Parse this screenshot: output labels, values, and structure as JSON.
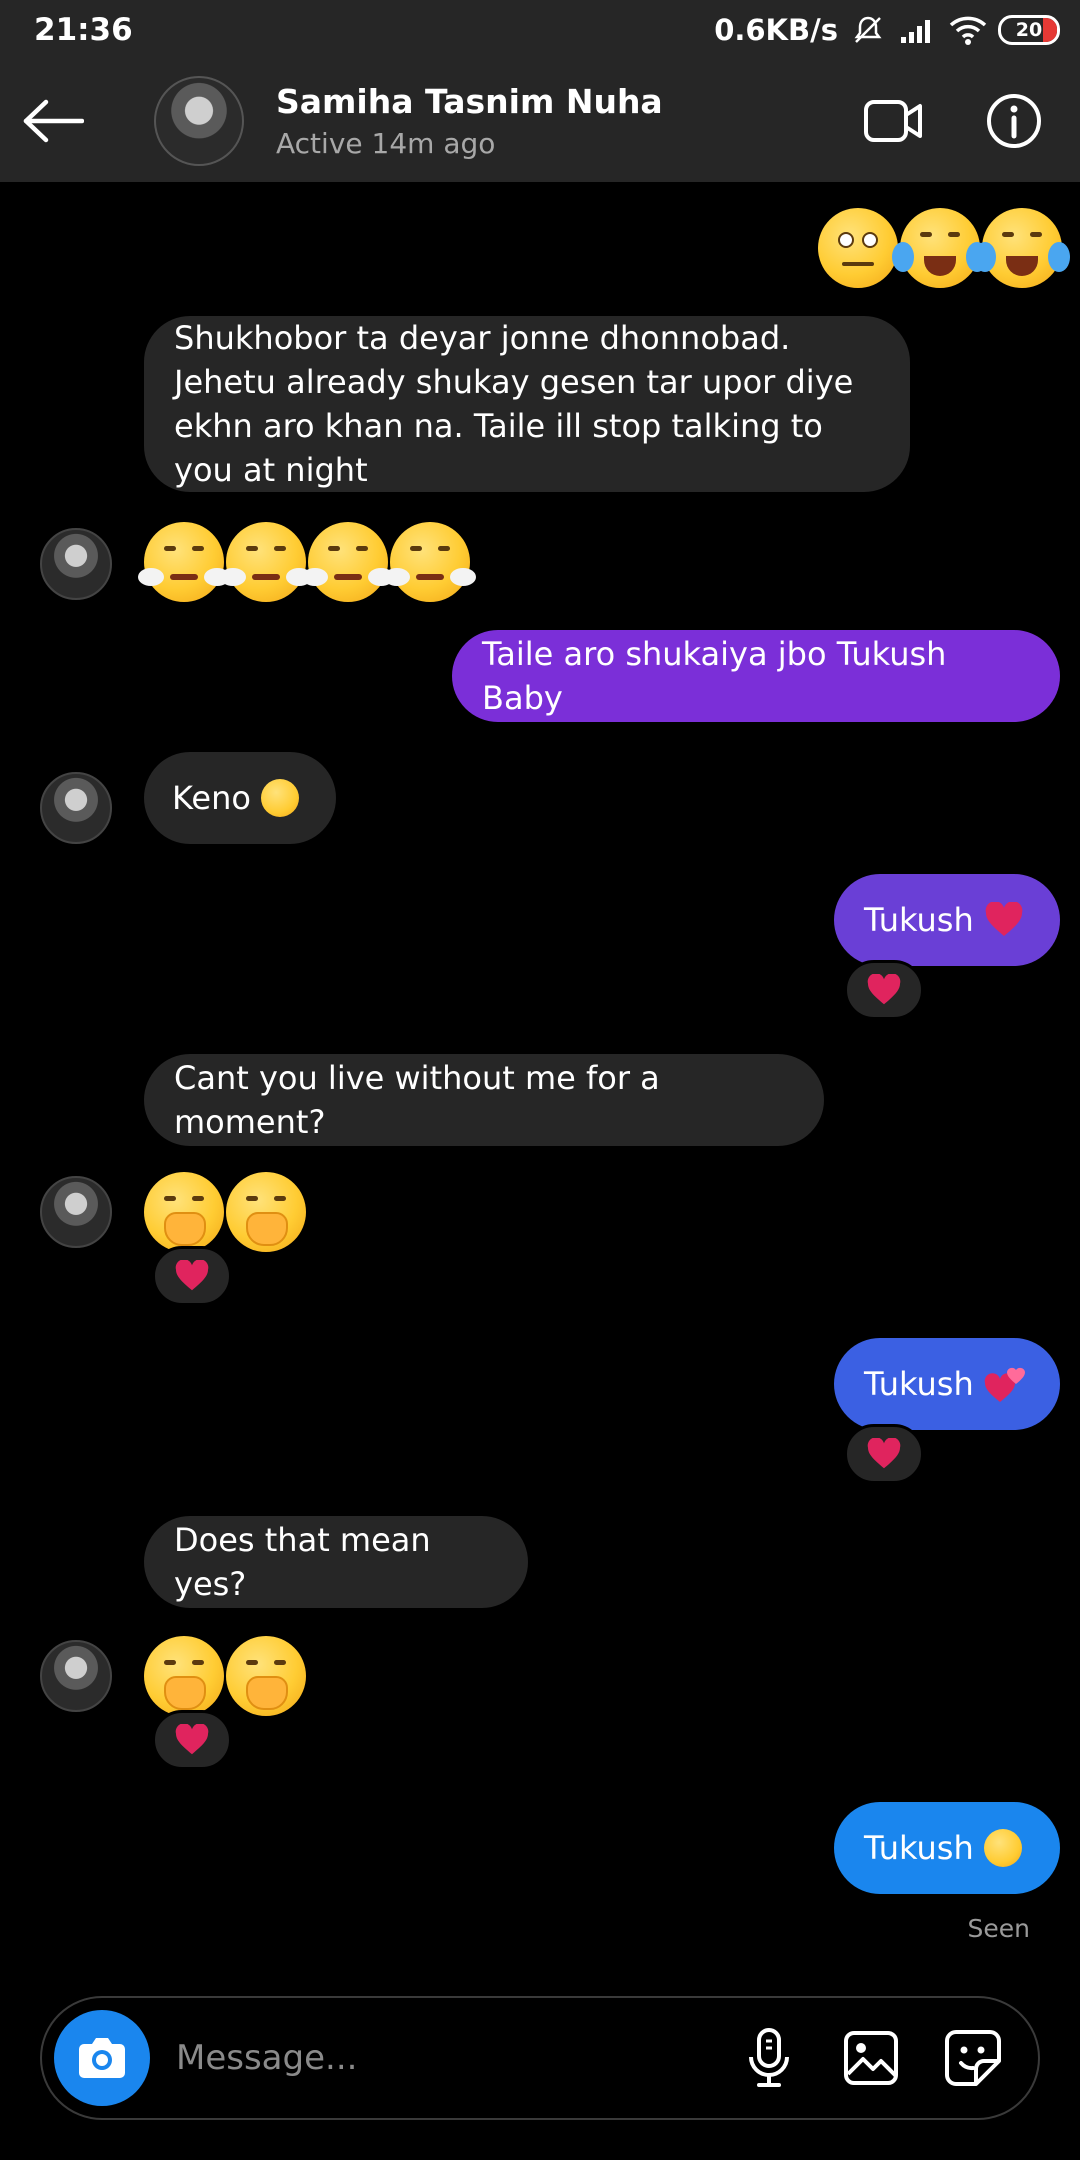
{
  "status_bar": {
    "time": "21:36",
    "network_speed": "0.6KB/s",
    "battery_level": "20",
    "icons": [
      "mute-icon",
      "signal-icon",
      "wifi-icon",
      "battery-icon"
    ]
  },
  "header": {
    "contact_name": "Samiha Tasnim Nuha",
    "active_status": "Active 14m ago",
    "icons": [
      "back-arrow-icon",
      "video-call-icon",
      "info-icon"
    ]
  },
  "messages": {
    "m1_text": "Shukhobor ta deyar jonne dhonnobad. Jehetu already shukay gesen tar upor diye ekhn aro khan na. Taile ill stop talking to you at night",
    "m2_text": "Taile aro shukaiya jbo Tukush Baby",
    "m3_text": "Keno",
    "m4_text": "Tukush",
    "m5_text": "Cant you live without me for a moment?",
    "m6_text": "Tukush",
    "m7_text": "Does that mean yes?",
    "m8_text": "Tukush"
  },
  "seen_label": "Seen",
  "composer": {
    "placeholder": "Message...",
    "icons": [
      "camera-icon",
      "microphone-icon",
      "gallery-icon",
      "sticker-icon"
    ]
  },
  "colors": {
    "header_bg": "#262626",
    "incoming_bubble": "#262626",
    "outgoing_purple": "#7b2fd8",
    "outgoing_blue": "#1a86ee",
    "reaction_heart": "#e0245e"
  }
}
